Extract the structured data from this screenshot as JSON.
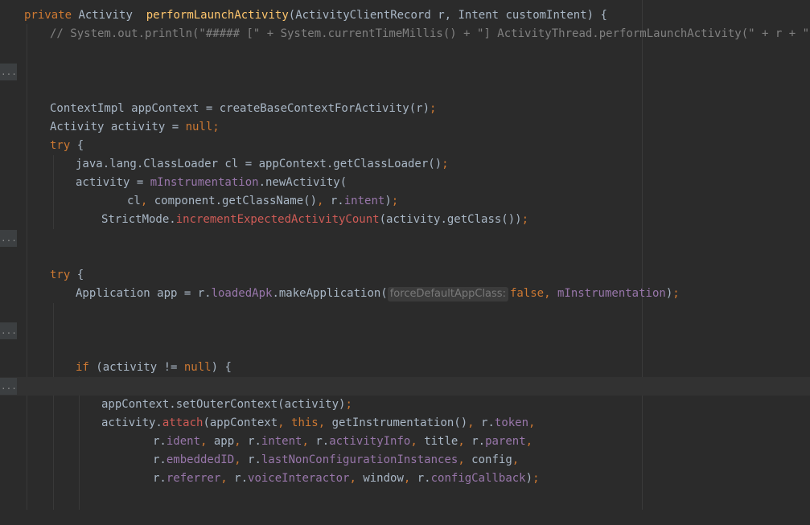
{
  "editor": {
    "fold_placeholder": "...",
    "method_signature": {
      "modifier": "private",
      "return_type": "Activity",
      "name": "performLaunchActivity",
      "params_open": "(ActivityClientRecord r, Intent customIntent) {"
    },
    "comment_line": "// System.out.println(\"##### [\" + System.currentTimeMillis() + \"] ActivityThread.performLaunchActivity(\" + r + \")\");",
    "context_line": {
      "text": "ContextImpl appContext = createBaseContextForActivity(r)",
      "semi": ";"
    },
    "activity_decl": {
      "prefix": "Activity activity = ",
      "value": "null",
      "semi": ";"
    },
    "try_kw": "try",
    "brace_open": " {",
    "classloader_line": {
      "text": "java.lang.ClassLoader cl = appContext.getClassLoader()",
      "semi": ";"
    },
    "new_activity_line": {
      "prefix": "activity = ",
      "field": "mInstrumentation",
      "suffix": ".newActivity("
    },
    "new_activity_args": {
      "a": "cl",
      "sep1": ", ",
      "b": "component.getClassName()",
      "sep2": ", ",
      "c": "r.",
      "d": "intent",
      "close": ")",
      "semi": ";"
    },
    "strictmode_line": {
      "prefix": "StrictMode.",
      "method": "incrementExpectedActivityCount",
      "suffix": "(activity.getClass())",
      "semi": ";"
    },
    "app_line": {
      "prefix": "Application app = r.",
      "field": "loadedApk",
      "method": ".makeApplication(",
      "hint": "forceDefaultAppClass:",
      "bool": "false",
      "sep": ", ",
      "arg2": "mInstrumentation",
      "close": ")",
      "semi": ";"
    },
    "if_line": {
      "kw": "if",
      "cond": " (activity != ",
      "null": "null",
      "close": ") {"
    },
    "outer_ctx_line": {
      "text": "appContext.setOuterContext(activity)",
      "semi": ";"
    },
    "attach_line": {
      "prefix": "activity.",
      "method": "attach",
      "open": "(appContext",
      "sep": ", ",
      "this": "this",
      "sep2": ", ",
      "getinst": "getInstrumentation()",
      "sep3": ", ",
      "r": "r.",
      "token": "token",
      "end": ","
    },
    "attach_args1": {
      "r1": "r.",
      "ident": "ident",
      "s1": ", ",
      "app": "app",
      "s2": ", ",
      "r2": "r.",
      "intent": "intent",
      "s3": ", ",
      "r3": "r.",
      "activityInfo": "activityInfo",
      "s4": ", ",
      "title": "title",
      "s5": ", ",
      "r4": "r.",
      "parent": "parent",
      "end": ","
    },
    "attach_args2": {
      "r1": "r.",
      "embeddedID": "embeddedID",
      "s1": ", ",
      "r2": "r.",
      "lastNonConfigurationInstances": "lastNonConfigurationInstances",
      "s2": ", ",
      "config": "config",
      "end": ","
    },
    "attach_args3": {
      "r1": "r.",
      "referrer": "referrer",
      "s1": ", ",
      "r2": "r.",
      "voiceInteractor": "voiceInteractor",
      "s2": ", ",
      "window": "window",
      "s3": ", ",
      "r3": "r.",
      "configCallback": "configCallback",
      "close": ")",
      "semi": ";"
    }
  },
  "colors": {
    "background": "#2b2b2b",
    "text": "#a9b7c6",
    "keyword": "#cc7832",
    "method_decl": "#ffc66d",
    "field": "#9876aa",
    "comment": "#808080",
    "error": "#cf5b56"
  }
}
